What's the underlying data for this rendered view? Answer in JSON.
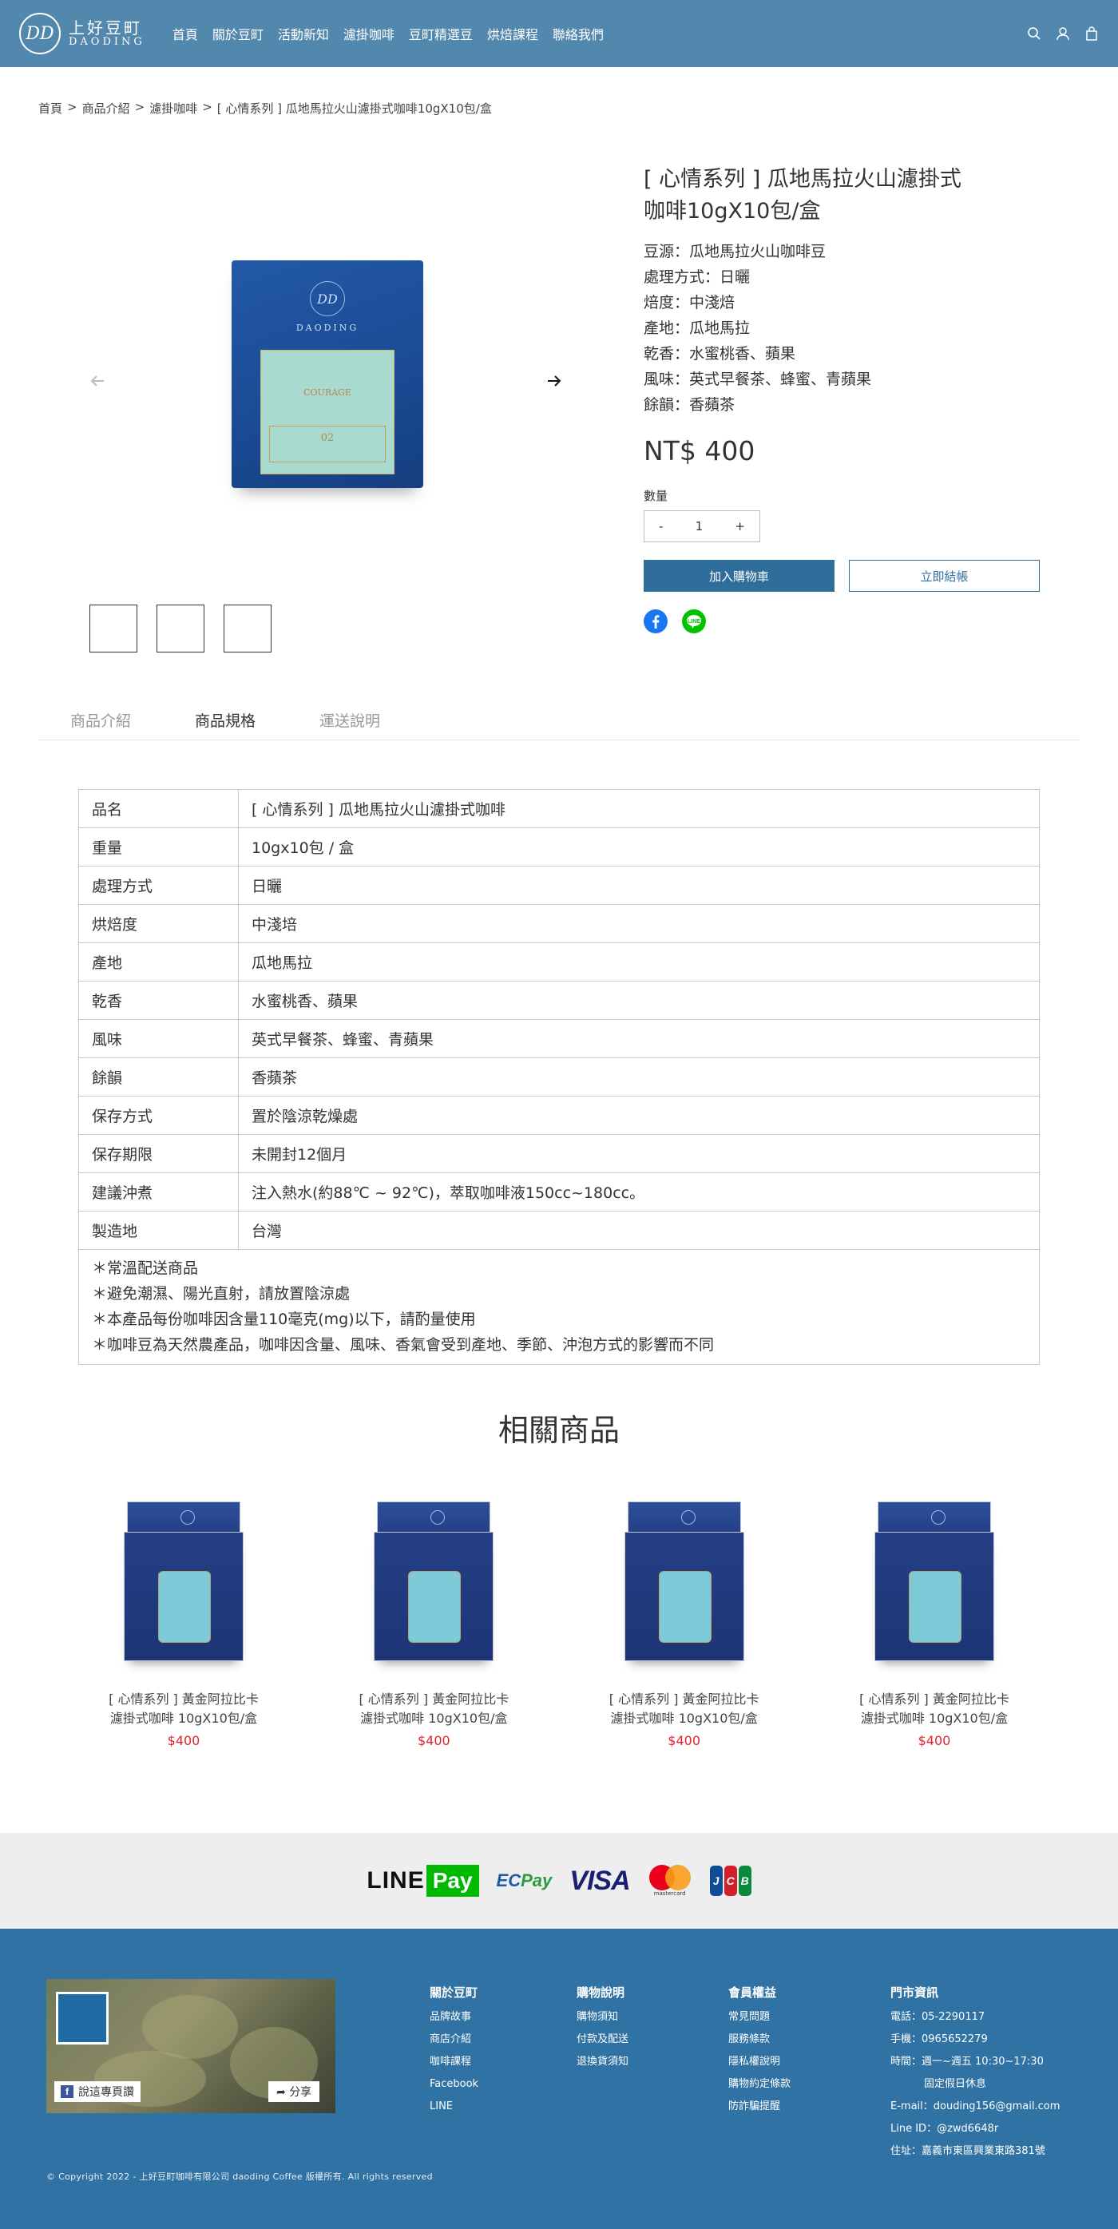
{
  "header": {
    "logo_cn": "上好豆町",
    "logo_en": "DAODING",
    "logo_mark": "DD",
    "nav": [
      "首頁",
      "關於豆町",
      "活動新知",
      "濾掛咖啡",
      "豆町精選豆",
      "烘焙課程",
      "聯絡我們"
    ],
    "icons": [
      "search-icon",
      "user-icon",
      "cart-icon"
    ]
  },
  "breadcrumb": [
    "首頁",
    ">",
    "商品介紹",
    ">",
    "濾掛咖啡",
    ">",
    "[ 心情系列 ] 瓜地馬拉火山濾掛式咖啡10gX10包/盒"
  ],
  "gallery": {
    "packet_brand": "DAODING",
    "packet_label_name": "COURAGE",
    "packet_label_num": "02"
  },
  "product": {
    "title_line1": "[ 心情系列 ] 瓜地馬拉火山濾掛式",
    "title_line2": "咖啡10gX10包/盒",
    "specs": [
      "豆源：瓜地馬拉火山咖啡豆",
      "處理方式：日曬",
      "焙度：中淺焙",
      "產地：瓜地馬拉",
      "乾香：水蜜桃香、蘋果",
      "風味：英式早餐茶、蜂蜜、青蘋果",
      "餘韻：香蘋茶"
    ],
    "price": "NT$ 400",
    "qty_label": "數量",
    "qty_minus": "-",
    "qty_value": "1",
    "qty_plus": "+",
    "add_to_cart": "加入購物車",
    "buy_now": "立即結帳"
  },
  "tabs": [
    "商品介紹",
    "商品規格",
    "運送說明"
  ],
  "spec_table": [
    [
      "品名",
      "[ 心情系列 ] 瓜地馬拉火山濾掛式咖啡"
    ],
    [
      "重量",
      "10gx10包 / 盒"
    ],
    [
      "處理方式",
      "日曬"
    ],
    [
      "烘焙度",
      "中淺培"
    ],
    [
      "產地",
      "瓜地馬拉"
    ],
    [
      "乾香",
      "水蜜桃香、蘋果"
    ],
    [
      "風味",
      "英式早餐茶、蜂蜜、青蘋果"
    ],
    [
      "餘韻",
      "香蘋茶"
    ],
    [
      "保存方式",
      "置於陰涼乾燥處"
    ],
    [
      "保存期限",
      "未開封12個月"
    ],
    [
      "建議沖煮",
      "注入熱水(約88℃ ~ 92℃)，萃取咖啡液150cc~180cc。"
    ],
    [
      "製造地",
      "台灣"
    ]
  ],
  "notes": [
    "＊常溫配送商品",
    "＊避免潮濕、陽光直射，請放置陰涼處",
    "＊本產品每份咖啡因含量110毫克(mg)以下，請酌量使用",
    "＊咖啡豆為天然農產品，咖啡因含量、風味、香氣會受到產地、季節、沖泡方式的影響而不同"
  ],
  "related": {
    "title": "相關商品",
    "items": [
      {
        "line1": "[ 心情系列 ] 黃金阿拉比卡",
        "line2": "濾掛式咖啡 10gX10包/盒",
        "price": "$400"
      },
      {
        "line1": "[ 心情系列 ] 黃金阿拉比卡",
        "line2": "濾掛式咖啡 10gX10包/盒",
        "price": "$400"
      },
      {
        "line1": "[ 心情系列 ] 黃金阿拉比卡",
        "line2": "濾掛式咖啡 10gX10包/盒",
        "price": "$400"
      },
      {
        "line1": "[ 心情系列 ] 黃金阿拉比卡",
        "line2": "濾掛式咖啡 10gX10包/盒",
        "price": "$400"
      }
    ]
  },
  "payments": {
    "linepay_line": "LINE",
    "linepay_pay": "Pay",
    "ecpay_ec": "EC",
    "ecpay_pay": "Pay",
    "visa": "VISA",
    "mastercard": "mastercard",
    "jcb": [
      "J",
      "C",
      "B"
    ]
  },
  "footer": {
    "fb_like": "說這專頁讚",
    "fb_share": "分享",
    "col1": {
      "title": "關於豆町",
      "links": [
        "品牌故事",
        "商店介紹",
        "咖啡課程",
        "Facebook",
        "LINE"
      ]
    },
    "col2": {
      "title": "購物說明",
      "links": [
        "購物須知",
        "付款及配送",
        "退換貨須知"
      ]
    },
    "col3": {
      "title": "會員權益",
      "links": [
        "常見問題",
        "服務條款",
        "隱私權說明",
        "購物約定條款",
        "防詐騙提醒"
      ]
    },
    "col4": {
      "title": "門市資訊",
      "lines": [
        "電話：05-2290117",
        "手機：0965652279",
        "時間：週一~週五 10:30~17:30",
        "固定假日休息",
        "E-mail：douding156@gmail.com",
        "Line ID：@zwd6648r",
        "住址：嘉義市東區興業東路381號"
      ]
    },
    "copyright": "© Copyright 2022 - 上好豆町咖啡有限公司 daoding Coffee 版權所有. All rights reserved"
  },
  "colors": {
    "header_bg": "#5288ae",
    "button_blue": "#2f6d9b",
    "footer_bg": "#2f72a3",
    "price_red": "#e0242b"
  }
}
